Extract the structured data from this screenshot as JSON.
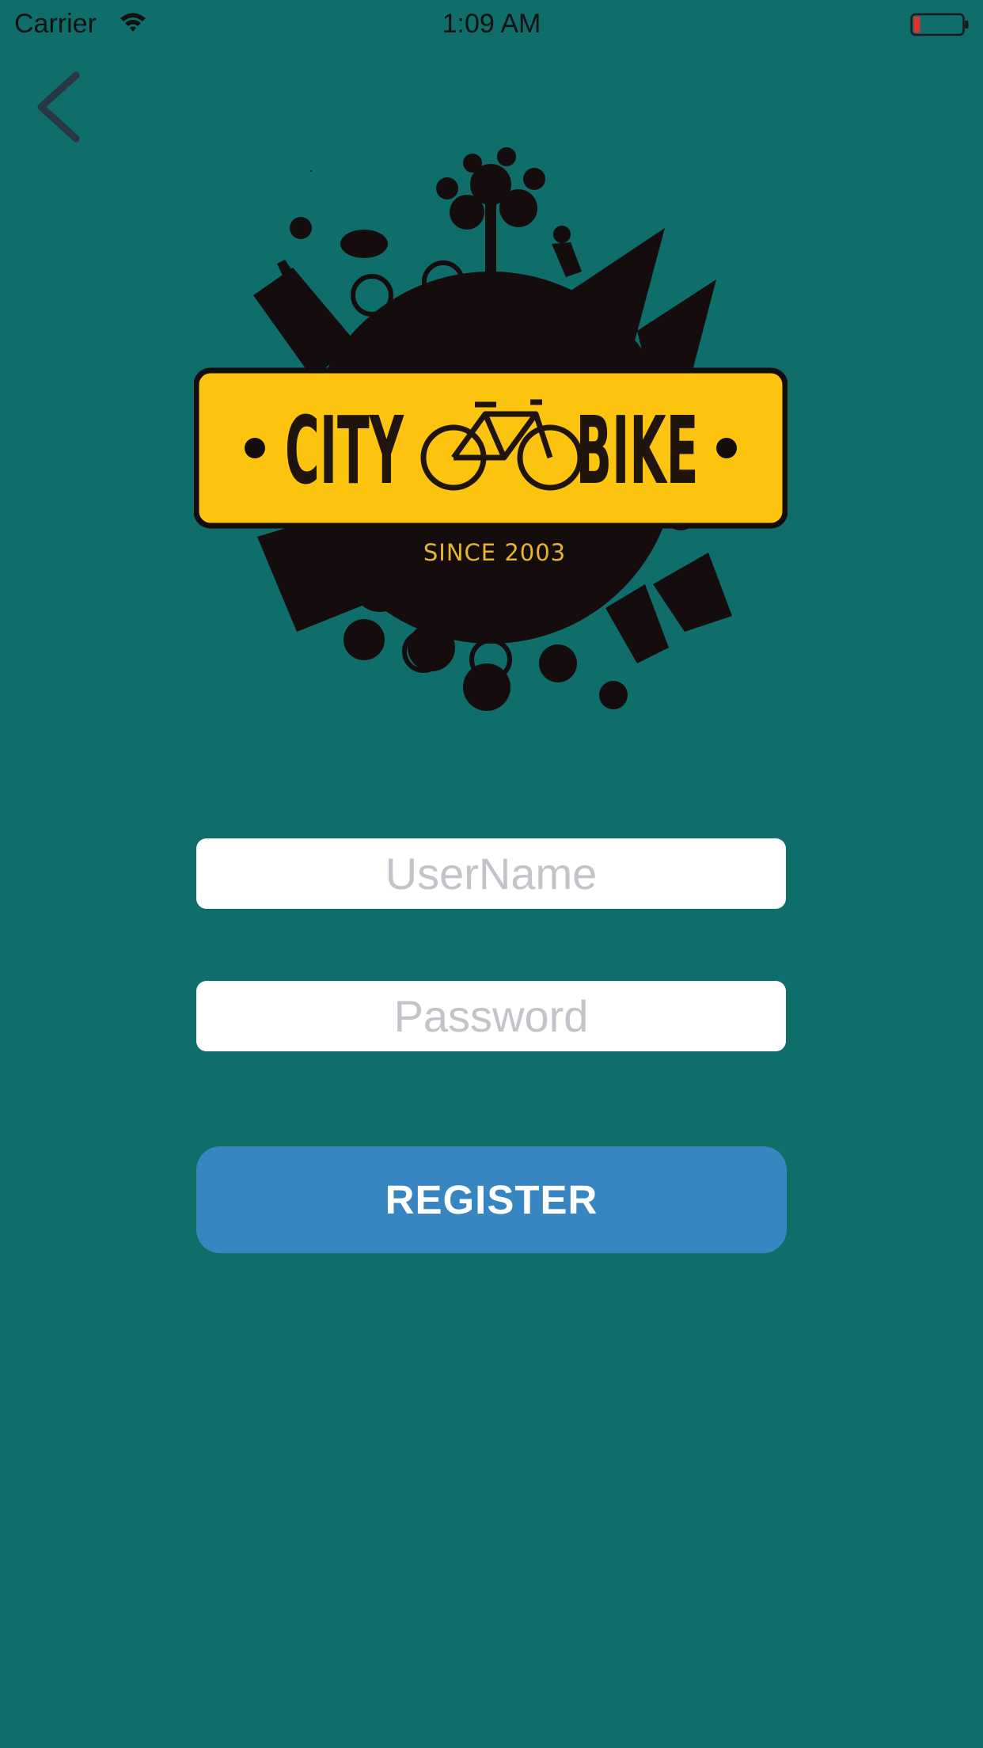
{
  "status_bar": {
    "carrier": "Carrier",
    "time": "1:09 AM",
    "battery_color": "#e0312f"
  },
  "nav": {
    "back_icon": "chevron-left-icon"
  },
  "logo": {
    "line1_left": "CITY",
    "line1_right": "BIKE",
    "tagline": "SINCE 2003",
    "plate_color": "#fcc40f",
    "globe_color": "#150c0d"
  },
  "form": {
    "username_placeholder": "UserName",
    "username_value": "",
    "password_placeholder": "Password",
    "password_value": "",
    "register_label": "REGISTER"
  },
  "colors": {
    "background": "#0f6d6a",
    "button": "#3786c2",
    "field": "#ffffff"
  }
}
